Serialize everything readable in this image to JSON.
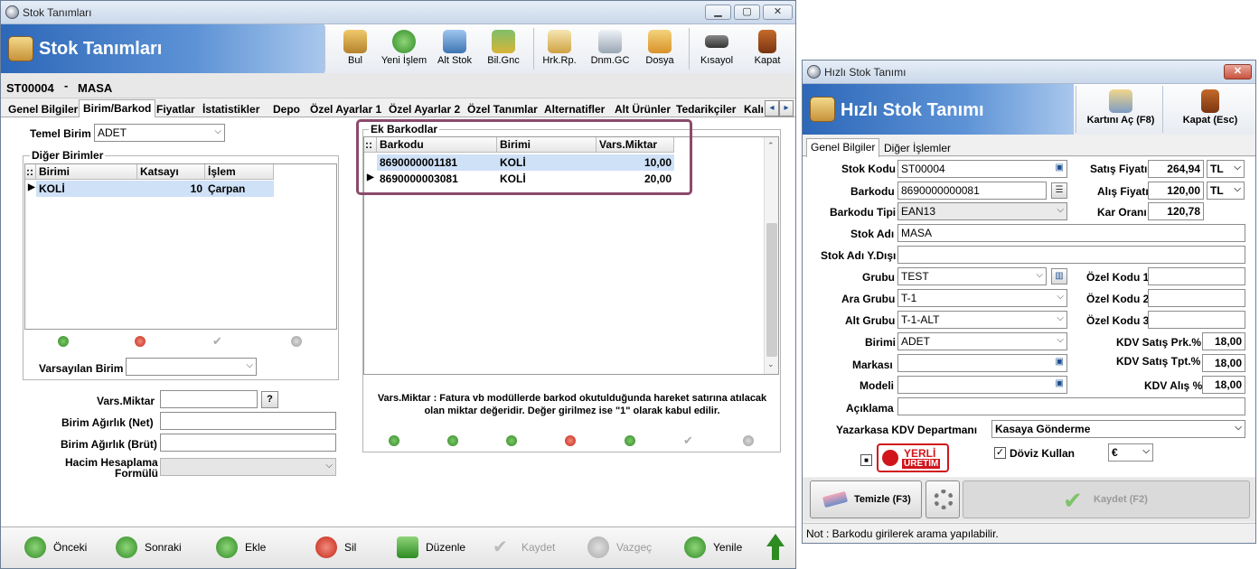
{
  "main": {
    "title": "Stok Tanımları",
    "banner_title": "Stok Tanımları",
    "toolbar": [
      "Bul",
      "Yeni İşlem",
      "Alt Stok",
      "Bil.Gnc",
      "Hrk.Rp.",
      "Dnm.GC",
      "Dosya",
      "Kısayol",
      "Kapat"
    ],
    "stock_code": "ST00004",
    "stock_sep": "-",
    "stock_name": "MASA",
    "tabs": [
      "Genel Bilgiler",
      "Birim/Barkod",
      "Fiyatlar",
      "İstatistikler",
      "Depo",
      "Özel Ayarlar 1",
      "Özel Ayarlar 2",
      "Özel Tanımlar",
      "Alternatifler",
      "Alt Ürünler",
      "Tedarikçiler",
      "Kalı"
    ],
    "temel_birim_label": "Temel Birim",
    "temel_birim_value": "ADET",
    "diger_birimler_title": "Diğer Birimler",
    "units_grid": {
      "columns": [
        "::",
        "Birimi",
        "Katsayı",
        "İşlem"
      ],
      "rows": [
        [
          "KOLİ",
          "10",
          "Çarpan"
        ]
      ]
    },
    "varsayilan_birim_label": "Varsayılan Birim",
    "vars_miktar_label": "Vars.Miktar",
    "help_btn": "?",
    "agirlik_net_label": "Birim Ağırlık (Net)",
    "agirlik_brut_label": "Birim Ağırlık (Brüt)",
    "hacim_label_1": "Hacim Hesaplama",
    "hacim_label_2": "Formülü",
    "ek_barkodlar_title": "Ek Barkodlar",
    "barcode_grid": {
      "columns": [
        "::",
        "Barkodu",
        "Birimi",
        "Vars.Miktar"
      ],
      "rows": [
        [
          "8690000001181",
          "KOLİ",
          "10,00"
        ],
        [
          "8690000003081",
          "KOLİ",
          "20,00"
        ]
      ]
    },
    "note_text": "Vars.Miktar : Fatura vb modüllerde barkod okutulduğunda hareket satırına atılacak olan miktar değeridir. Değer girilmez ise \"1\" olarak kabul edilir.",
    "bottom": [
      "Önceki",
      "Sonraki",
      "Ekle",
      "Sil",
      "Düzenle",
      "Kaydet",
      "Vazgeç",
      "Yenile"
    ],
    "highlight_color": "#8b4a6b"
  },
  "quick": {
    "title": "Hızlı Stok Tanımı",
    "banner_title": "Hızlı Stok Tanımı",
    "open_card_btn": "Kartını Aç (F8)",
    "close_btn": "Kapat (Esc)",
    "tabs": [
      "Genel Bilgiler",
      "Diğer İşlemler"
    ],
    "stok_kodu_label": "Stok Kodu",
    "stok_kodu": "ST00004",
    "barkodu_label": "Barkodu",
    "barkodu": "8690000000081",
    "barkod_tipi_label": "Barkodu Tipi",
    "barkod_tipi": "EAN13",
    "stok_adi_label": "Stok Adı",
    "stok_adi": "MASA",
    "stok_adi_yd_label": "Stok Adı Y.Dışı",
    "grubu_label": "Grubu",
    "grubu": "TEST",
    "ara_grubu_label": "Ara Grubu",
    "ara_grubu": "T-1",
    "alt_grubu_label": "Alt Grubu",
    "alt_grubu": "T-1-ALT",
    "birimi_label": "Birimi",
    "birimi": "ADET",
    "markasi_label": "Markası",
    "modeli_label": "Modeli",
    "aciklama_label": "Açıklama",
    "satis_fiyati_label": "Satış Fiyatı",
    "satis_fiyati": "264,94",
    "satis_cur": "TL",
    "alis_fiyati_label": "Alış Fiyatı",
    "alis_fiyati": "120,00",
    "alis_cur": "TL",
    "kar_orani_label": "Kar Oranı",
    "kar_orani": "120,78",
    "ozel_kodu_1_label": "Özel Kodu 1",
    "ozel_kodu_2_label": "Özel Kodu 2",
    "ozel_kodu_3_label": "Özel Kodu 3",
    "kdv_satis_prk_label": "KDV Satış Prk.%",
    "kdv_satis_prk": "18,00",
    "kdv_satis_tpt_label": "KDV Satış Tpt.%",
    "kdv_satis_tpt": "18,00",
    "kdv_alis_label": "KDV Alış %",
    "kdv_alis": "18,00",
    "yazarkasa_label": "Yazarkasa KDV Departmanı",
    "yazarkasa": "Kasaya Gönderme",
    "yerli_1": "YERLİ",
    "yerli_2": "ÜRETİM",
    "doviz_label": "Döviz Kullan",
    "doviz": "€",
    "temizle_btn": "Temizle (F3)",
    "kaydet_btn": "Kaydet (F2)",
    "note": "Not : Barkodu girilerek arama yapılabilir."
  }
}
